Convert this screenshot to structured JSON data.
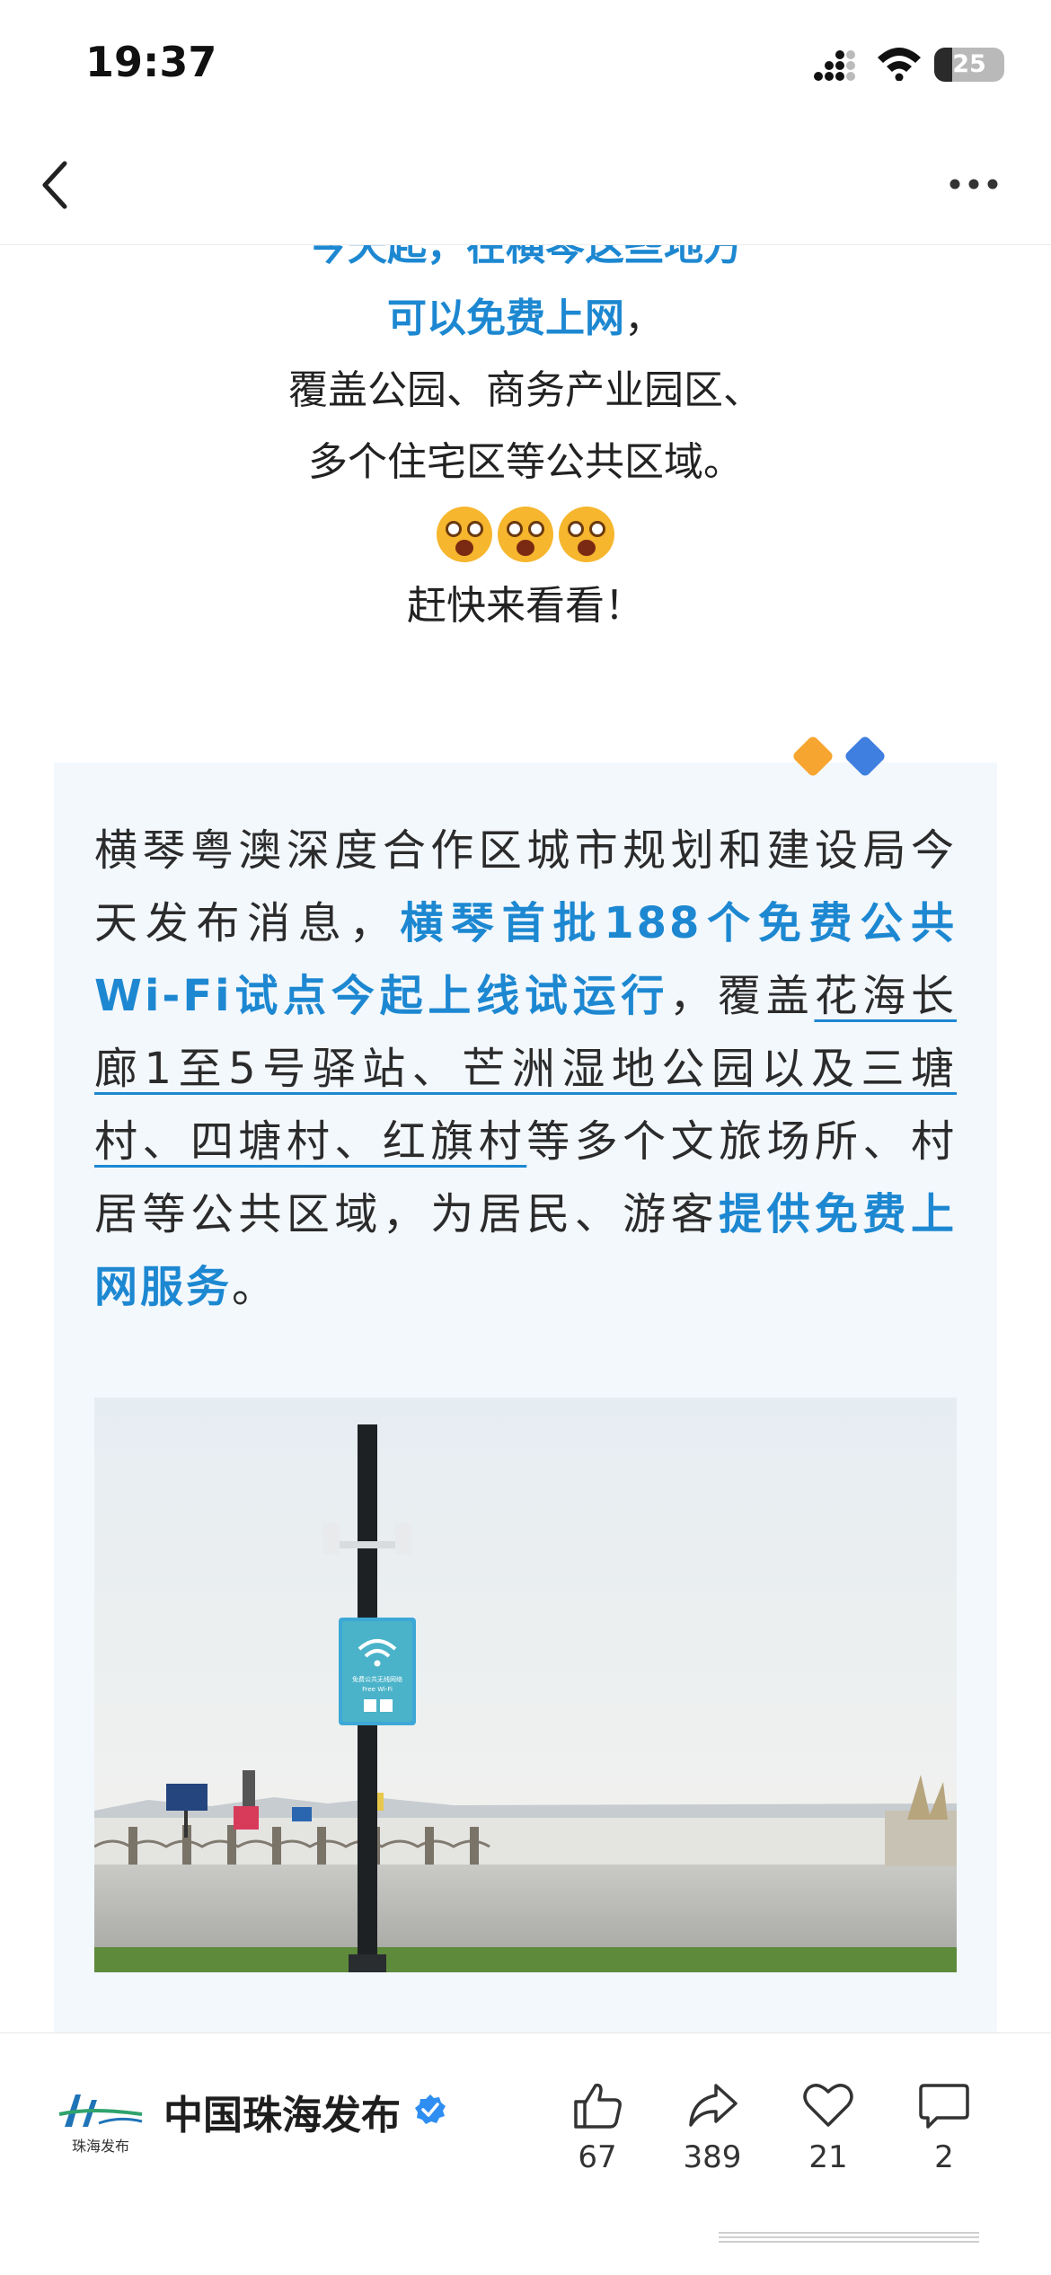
{
  "status_bar": {
    "time": "19:37",
    "battery_percent": "25",
    "battery_level": 0.25
  },
  "intro": {
    "cut_line": "今天起，在横琴这些地方",
    "line1_highlight": "可以免费上网",
    "line1_rest": "，",
    "line2": "覆盖公园、商务产业园区、",
    "line3": "多个住宅区等公共区域。",
    "line4": "赶快来看看！"
  },
  "card": {
    "t1": "横琴粤澳深度合作区城市规划和建设局今天发布消息，",
    "t2": "横琴首批188个免费公共Wi-Fi试点今起上线试运行",
    "t3": "，覆盖",
    "t4": "花海长廊1至5号驿站、芒洲湿地公园以及三塘村、四塘村、红旗村",
    "t5": "等多个文旅场所、村居等公共区域，为居民、游客",
    "t6": "提供免费上网服务",
    "t7": "。"
  },
  "photo": {
    "sign_title": "免费公共无线网络",
    "sign_sub": "Free Wi-Fi"
  },
  "account": {
    "name": "中国珠海发布",
    "logo_text": "珠海发布"
  },
  "actions": [
    {
      "name": "like",
      "count": "67"
    },
    {
      "name": "share",
      "count": "389"
    },
    {
      "name": "favorite",
      "count": "21"
    },
    {
      "name": "comment",
      "count": "2"
    }
  ],
  "colors": {
    "accent": "#1d88d1",
    "diamond_orange": "#f7a531",
    "diamond_blue": "#3f7fe0",
    "card_bg": "#f3f8fd"
  }
}
